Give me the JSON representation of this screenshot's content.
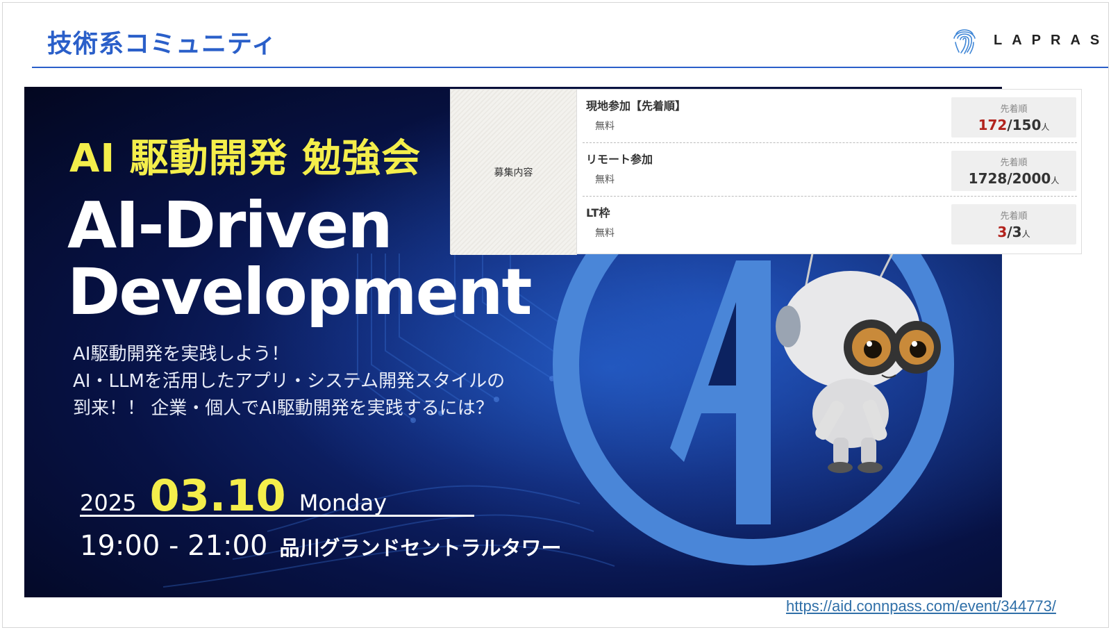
{
  "slide": {
    "title": "技術系コミュニティ",
    "logo_text": "LAPRAS",
    "url": "https://aid.connpass.com/event/344773/"
  },
  "banner": {
    "jp_title": "AI 駆動開発 勉強会",
    "en_title_line1": "AI-Driven",
    "en_title_line2": "Development",
    "desc_line1": "AI駆動開発を実践しよう！",
    "desc_line2": "AI・LLMを活用したアプリ・システム開発スタイルの",
    "desc_line3": "到来！！ 企業・個人でAI駆動開発を実践するには？",
    "year": "2025",
    "month_day": "03.10",
    "weekday": "Monday",
    "hours": "19:00 - 21:00",
    "venue": "品川グランドセントラルタワー"
  },
  "recruitment": {
    "label": "募集内容",
    "rows": [
      {
        "name": "現地参加【先着順】",
        "fee": "無料",
        "type": "先着順",
        "current": "172",
        "sep": "/",
        "capacity": "150",
        "unit": "人"
      },
      {
        "name": "リモート参加",
        "fee": "無料",
        "type": "先着順",
        "current": "1728",
        "sep": "/",
        "capacity": "2000",
        "unit": "人"
      },
      {
        "name": "LT枠",
        "fee": "無料",
        "type": "先着順",
        "current": "3",
        "sep": "/",
        "capacity": "3",
        "unit": "人"
      }
    ]
  },
  "colors": {
    "accent": "#2a5fc9",
    "highlight_yellow": "#f4ee4b",
    "over_capacity_red": "#b2231d",
    "banner_logo_blue": "#4a86d8"
  }
}
